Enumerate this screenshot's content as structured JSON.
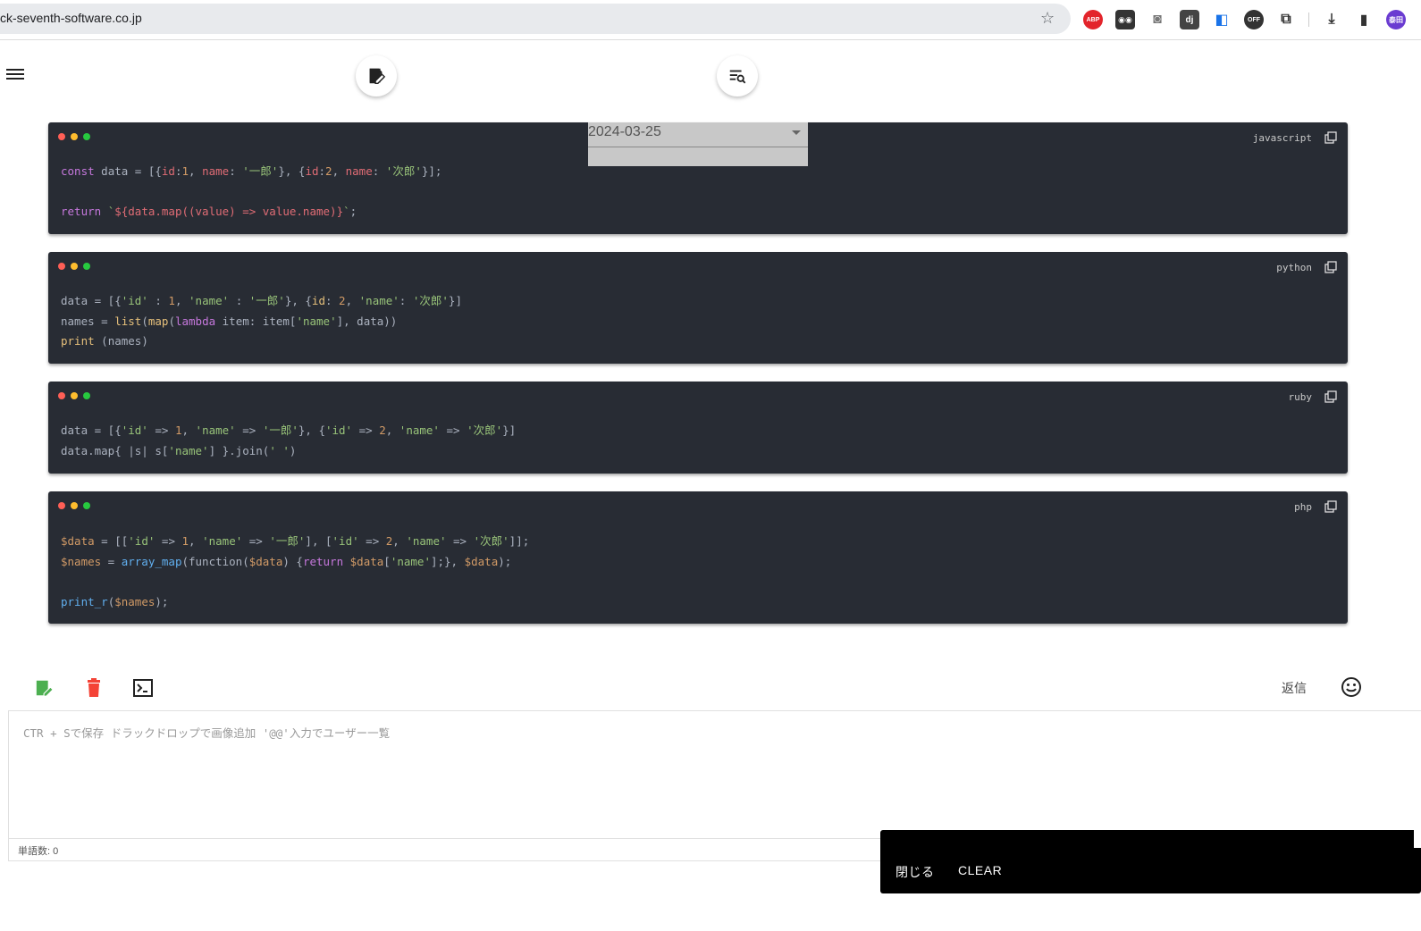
{
  "browser": {
    "url": "ck-seventh-software.co.jp",
    "extensions": [
      "ABP",
      "mask",
      "camera",
      "dj",
      "translate",
      "OFF",
      "puzzle",
      "download",
      "sidepanel",
      "avatar"
    ],
    "avatar_text": "泰田"
  },
  "header": {
    "menu_icon": "hamburger-icon",
    "fab_left_icon": "edit-note-icon",
    "fab_right_icon": "filter-search-icon"
  },
  "date_select": {
    "value": "2024-03-25"
  },
  "code_blocks": [
    {
      "lang": "javascript"
    },
    {
      "lang": "python"
    },
    {
      "lang": "ruby"
    },
    {
      "lang": "php"
    }
  ],
  "toolbar": {
    "reply_label": "返信"
  },
  "editor": {
    "placeholder": "CTR + Sで保存 ドラックドロップで画像追加 '@@'入力でユーザー一覧",
    "word_count": "単語数: 0"
  },
  "snackbar": {
    "close_label": "閉じる",
    "clear_label": "CLEAR"
  },
  "colors": {
    "code_bg": "#282c34",
    "save_green": "#4caf50",
    "delete_red": "#f44336",
    "snackbar_bg": "#000000"
  }
}
